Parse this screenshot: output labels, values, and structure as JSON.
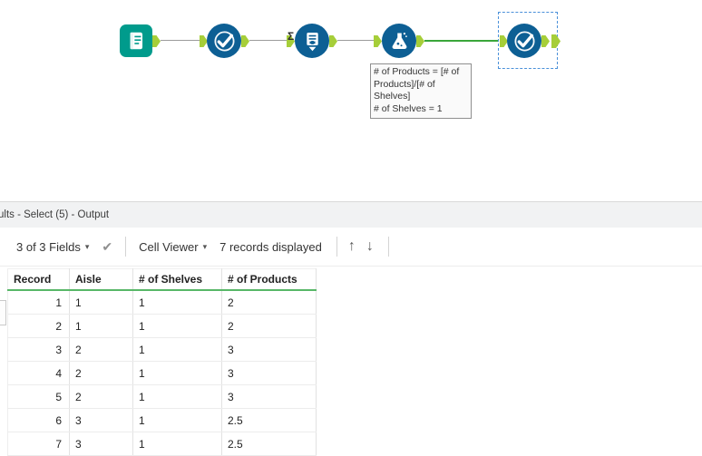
{
  "workflow": {
    "sigma": "Σ",
    "annotation": {
      "line1": "# of Products = [# of Products]/[# of Shelves]",
      "line2": "# of Shelves = 1"
    },
    "tool_icons": [
      "input-data-icon",
      "select-check-icon",
      "summarize-icon",
      "formula-flask-icon",
      "select-check-icon"
    ]
  },
  "results": {
    "titlebar": "ults - Select (5) - Output",
    "toolbar": {
      "fields": "3 of 3 Fields",
      "cell_viewer": "Cell Viewer",
      "records": "7 records displayed"
    },
    "icons": {
      "caret": "▾",
      "check": "✔",
      "up": "↑",
      "down": "↓"
    },
    "table": {
      "columns": [
        "Record",
        "Aisle",
        "# of Shelves",
        "# of Products"
      ],
      "rows": [
        [
          "1",
          "1",
          "1",
          "2"
        ],
        [
          "2",
          "1",
          "1",
          "2"
        ],
        [
          "3",
          "2",
          "1",
          "3"
        ],
        [
          "4",
          "2",
          "1",
          "3"
        ],
        [
          "5",
          "2",
          "1",
          "3"
        ],
        [
          "6",
          "3",
          "1",
          "2.5"
        ],
        [
          "7",
          "3",
          "1",
          "2.5"
        ]
      ]
    }
  },
  "colors": {
    "tool_blue": "#0d5f94",
    "input_teal": "#009b8c",
    "anchor_green": "#a6ce39",
    "wire_green": "#3aa63a",
    "header_green": "#58b768",
    "selection_blue": "#4a90d9"
  }
}
